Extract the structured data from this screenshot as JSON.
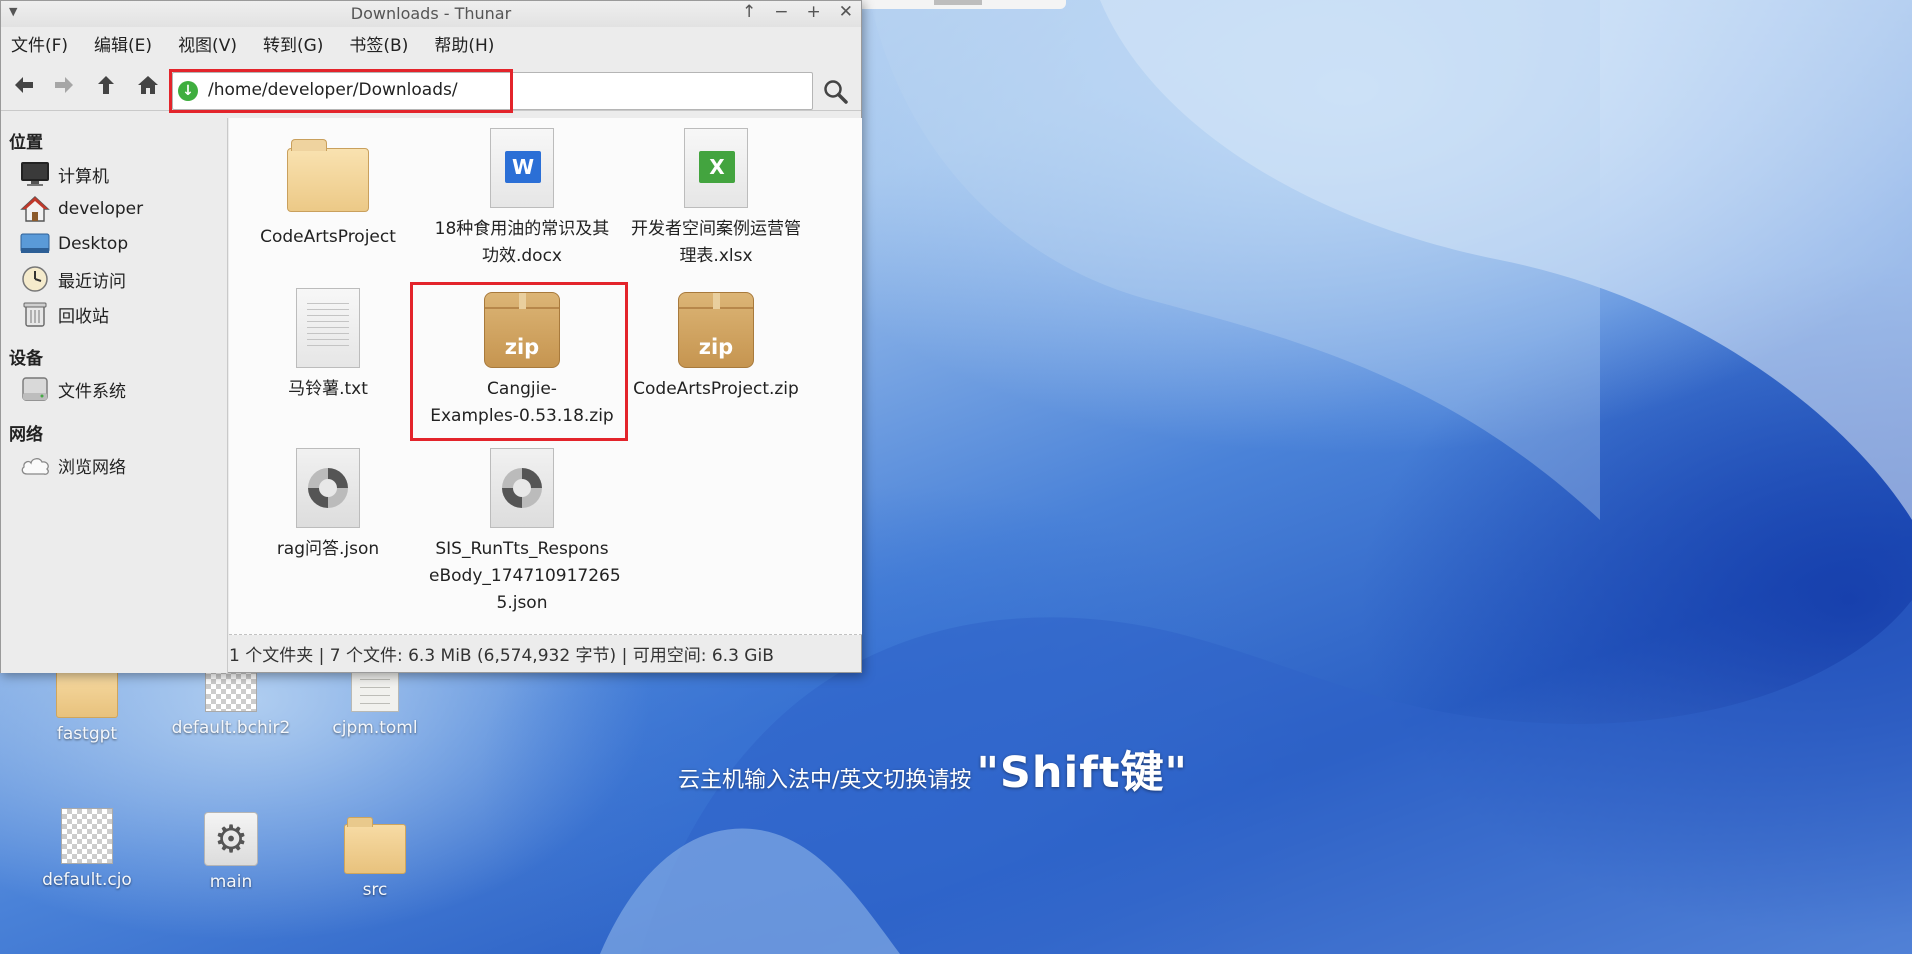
{
  "window": {
    "title": "Downloads - Thunar",
    "controls": [
      "↑",
      "−",
      "+",
      "✕"
    ]
  },
  "menu": [
    "文件(F)",
    "编辑(E)",
    "视图(V)",
    "转到(G)",
    "书签(B)",
    "帮助(H)"
  ],
  "address": {
    "path": "/home/developer/Downloads/"
  },
  "sidebar": {
    "places_heading": "位置",
    "places": [
      {
        "label": "计算机",
        "icon": "monitor-icon"
      },
      {
        "label": "developer",
        "icon": "home-icon"
      },
      {
        "label": "Desktop",
        "icon": "desktop-icon"
      },
      {
        "label": "最近访问",
        "icon": "clock-icon"
      },
      {
        "label": "回收站",
        "icon": "trash-icon"
      }
    ],
    "devices_heading": "设备",
    "devices": [
      {
        "label": "文件系统",
        "icon": "drive-icon"
      }
    ],
    "network_heading": "网络",
    "network": [
      {
        "label": "浏览网络",
        "icon": "cloud-icon"
      }
    ]
  },
  "files": [
    {
      "name": "CodeArtsProject",
      "type": "folder"
    },
    {
      "name": "18种食用油的常识及其功效.docx",
      "line1": "18种食用油的常识及其",
      "line2": "功效.docx",
      "type": "docx"
    },
    {
      "name": "开发者空间案例运营管理表.xlsx",
      "line1": "开发者空间案例运营管",
      "line2": "理表.xlsx",
      "type": "xlsx"
    },
    {
      "name": "马铃薯.txt",
      "type": "txt"
    },
    {
      "name": "Cangjie-Examples-0.53.18.zip",
      "line1": "Cangjie-",
      "line2": "Examples-0.53.18.zip",
      "type": "zip",
      "badge": "zip"
    },
    {
      "name": "CodeArtsProject.zip",
      "type": "zip",
      "badge": "zip"
    },
    {
      "name": "rag问答.json",
      "type": "json"
    },
    {
      "name": "SIS_RunTts_ResponseBody_1747109172655.json",
      "line1": "SIS_RunTts_Respons",
      "line2": "eBody_174710917265",
      "line3": "5.json",
      "type": "json"
    }
  ],
  "status": "1 个文件夹 | 7 个文件: 6.3 MiB (6,574,932 字节) | 可用空间: 6.3 GiB",
  "desktop": {
    "icons": [
      {
        "label": "fastgpt",
        "icon": "folder-icon"
      },
      {
        "label": "default.bchir2",
        "icon": "binary-file-icon"
      },
      {
        "label": "cjpm.toml",
        "icon": "text-file-icon"
      },
      {
        "label": "default.cjo",
        "icon": "binary-file-icon"
      },
      {
        "label": "main",
        "icon": "executable-icon"
      },
      {
        "label": "src",
        "icon": "folder-icon"
      }
    ],
    "ime_hint_prefix": "云主机输入法中/英文切换请按",
    "ime_hint_key": "\"Shift键\""
  },
  "colors": {
    "highlight": "#e3242b",
    "accent": "#3fae3f"
  }
}
